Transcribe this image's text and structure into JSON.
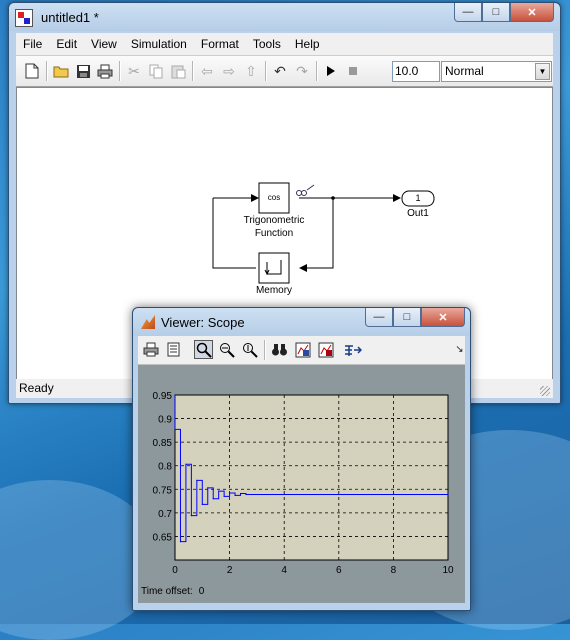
{
  "simulink": {
    "title": "untitled1 *",
    "menu": [
      "File",
      "Edit",
      "View",
      "Simulation",
      "Format",
      "Tools",
      "Help"
    ],
    "stop_time": "10.0",
    "sim_mode": "Normal",
    "status": "Ready",
    "blocks": {
      "trig_symbol": "cos",
      "trig_label_line1": "Trigonometric",
      "trig_label_line2": "Function",
      "memory_label": "Memory",
      "out_port_number": "1",
      "out_label": "Out1"
    }
  },
  "scope": {
    "title": "Viewer: Scope",
    "time_offset_label": "Time offset:",
    "time_offset_value": "0"
  },
  "chart_data": {
    "type": "line",
    "step_plot": true,
    "xlim": [
      0,
      10
    ],
    "ylim": [
      0.6,
      0.95
    ],
    "xticks": [
      0,
      2,
      4,
      6,
      8,
      10
    ],
    "yticks": [
      0.65,
      0.7,
      0.75,
      0.8,
      0.85,
      0.9,
      0.95
    ],
    "grid": true,
    "colors": {
      "line": "#0000ff",
      "plot_bg": "#d4d2bc",
      "frame_bg": "#8c989c"
    },
    "series": [
      {
        "x": [
          0,
          0.2,
          0.4,
          0.6,
          0.8,
          1.0,
          1.2,
          1.4,
          1.6,
          1.8,
          2.0,
          2.2,
          2.4,
          2.6,
          10
        ],
        "y": [
          0.877,
          0.639,
          0.803,
          0.694,
          0.769,
          0.718,
          0.753,
          0.73,
          0.746,
          0.735,
          0.742,
          0.737,
          0.741,
          0.739,
          0.739
        ]
      }
    ]
  }
}
